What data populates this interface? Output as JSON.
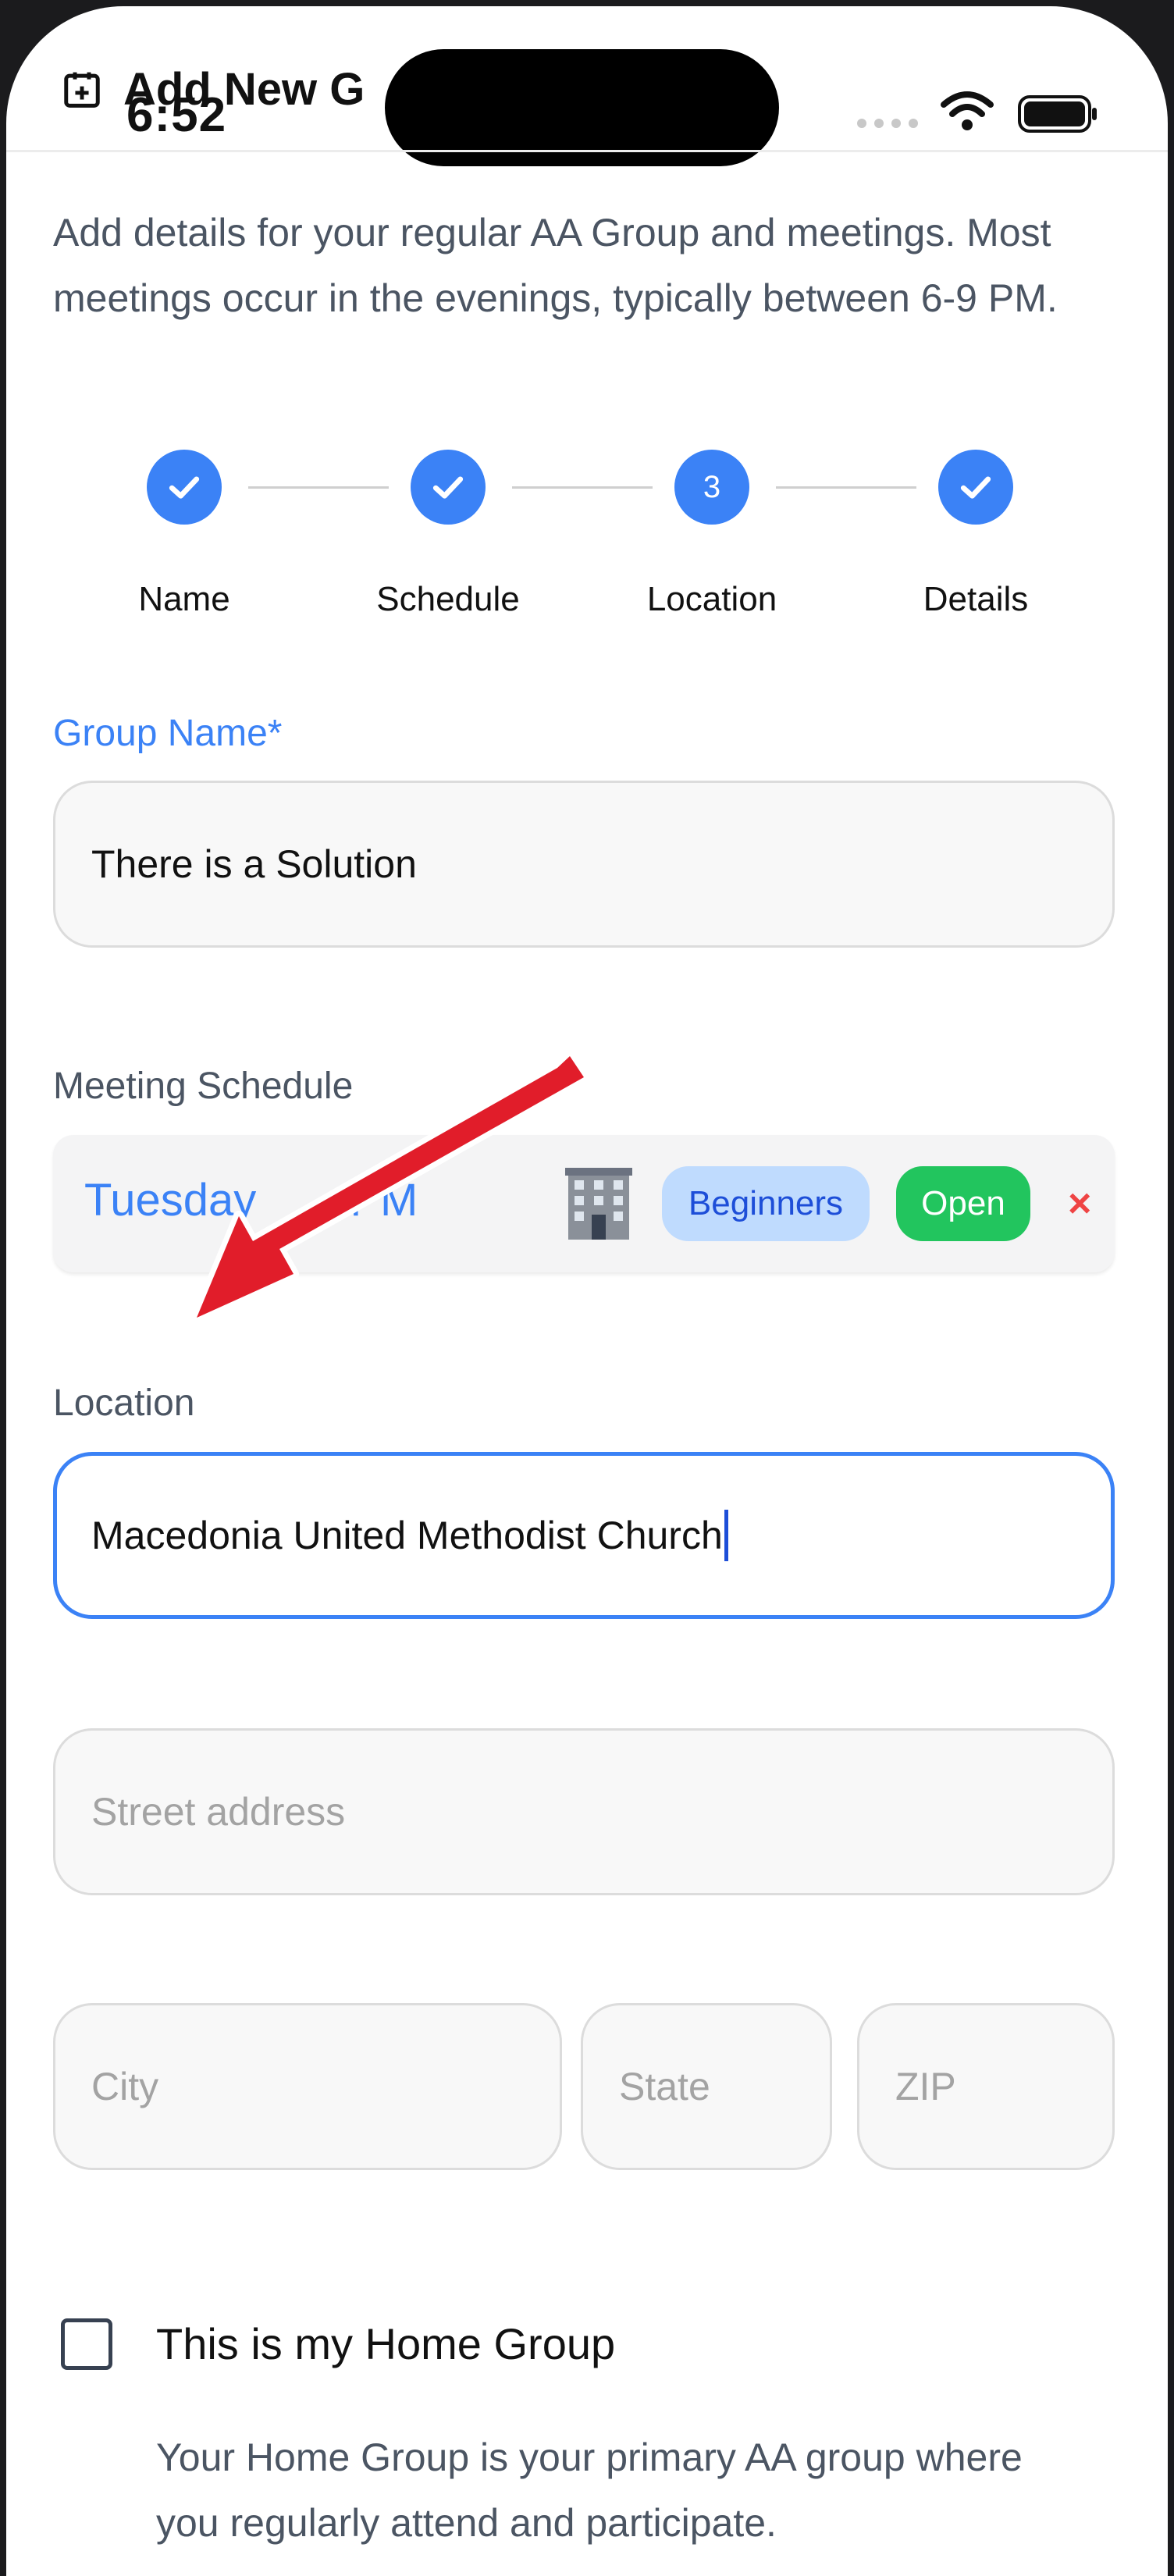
{
  "status_bar": {
    "time": "6:52"
  },
  "header": {
    "title": "Add New G"
  },
  "intro": "Add details for your regular AA Group and meetings. Most meetings occur in the evenings, typically between 6-9 PM.",
  "stepper": {
    "steps": [
      {
        "label": "Name",
        "state": "complete"
      },
      {
        "label": "Schedule",
        "state": "complete"
      },
      {
        "label": "Location",
        "state": "current",
        "number": "3"
      },
      {
        "label": "Details",
        "state": "complete"
      }
    ]
  },
  "group_name": {
    "label": "Group Name*",
    "value": "There is a Solution"
  },
  "meeting_schedule": {
    "label": "Meeting Schedule",
    "day": "Tuesday",
    "time_suffix": "PM",
    "icon": "building-icon",
    "tags": [
      "Beginners",
      "Open"
    ],
    "remove_symbol": "×"
  },
  "location": {
    "label": "Location",
    "value": "Macedonia United Methodist Church",
    "street_placeholder": "Street address",
    "city_placeholder": "City",
    "state_placeholder": "State",
    "zip_placeholder": "ZIP"
  },
  "home_group": {
    "label": "This is my Home Group",
    "checked": false,
    "help": "Your Home Group is your primary AA group where you regularly attend and participate."
  },
  "colors": {
    "accent": "#3b82f6",
    "open_badge": "#22c55e",
    "beginners_badge": "#bfdbfe",
    "remove": "#ef4444",
    "annotation_arrow": "#e11d2a"
  }
}
